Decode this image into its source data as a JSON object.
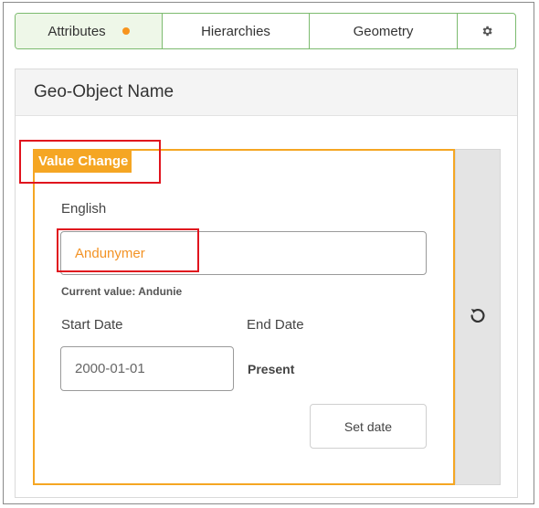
{
  "tabs": [
    {
      "label": "Attributes",
      "active": true,
      "indicator_color": "#f7941d"
    },
    {
      "label": "Hierarchies",
      "active": false
    },
    {
      "label": "Geometry",
      "active": false
    },
    {
      "label": "",
      "icon": "gear-icon"
    }
  ],
  "panel": {
    "title": "Geo-Object Name"
  },
  "value_change": {
    "badge": "Value Change",
    "accent_color": "#f5a623",
    "field_label": "English",
    "field_value": "Andunymer",
    "current_value": "Current value: Andunie",
    "start_date_label": "Start Date",
    "end_date_label": "End Date",
    "start_date_value": "2000-01-01",
    "end_date_value": "Present",
    "set_date_button": "Set date",
    "revert_icon": "undo-icon"
  },
  "annotations": {
    "highlight_color": "#e0141e"
  }
}
